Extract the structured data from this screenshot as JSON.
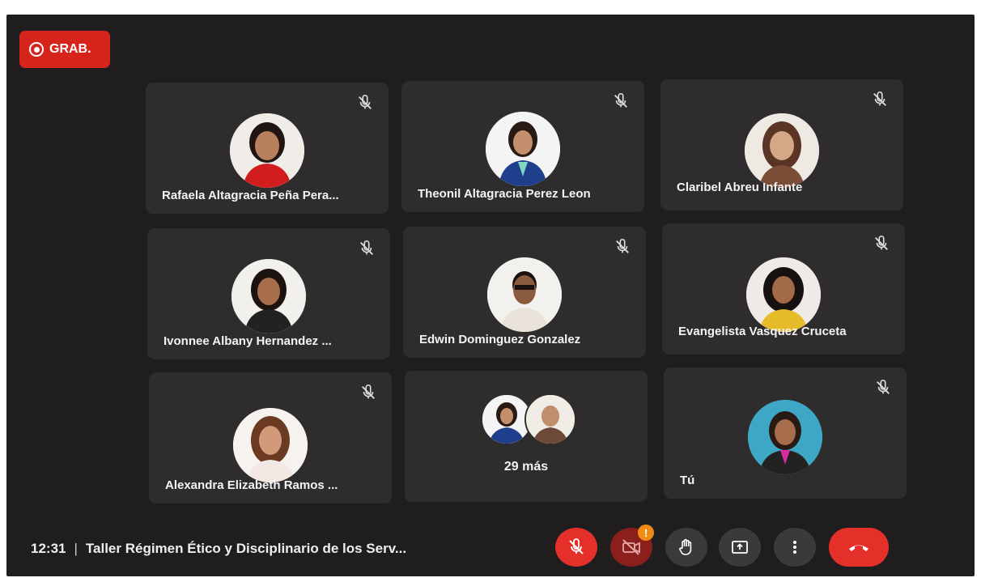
{
  "recording": {
    "label": "GRAB."
  },
  "participants": [
    {
      "name": "Rafaela Altagracia Peña Pera...",
      "muted": true,
      "shirt": "#d11d1d",
      "skin": "#b9805e",
      "hair": "#201512"
    },
    {
      "name": "Theonil Altagracia Perez Leon",
      "muted": true,
      "shirt": "#1f3f8c",
      "skin": "#c48f6c",
      "hair": "#2a1a14"
    },
    {
      "name": "Claribel Abreu Infante",
      "muted": true,
      "shirt": "#7a4d37",
      "skin": "#d5a787",
      "hair": "#5a3526"
    },
    {
      "name": "Ivonnee Albany Hernandez ...",
      "muted": true,
      "shirt": "#222222",
      "skin": "#a86e4c",
      "hair": "#1c120e"
    },
    {
      "name": "Edwin Dominguez Gonzalez",
      "muted": true,
      "shirt": "#e8e2d8",
      "skin": "#8a5a3e",
      "hair": "#1a1210"
    },
    {
      "name": "Evangelista Vasquez Cruceta",
      "muted": true,
      "shirt": "#e6bb2a",
      "skin": "#a36a47",
      "hair": "#161010"
    },
    {
      "name": "Alexandra Elizabeth Ramos ...",
      "muted": true,
      "shirt": "#f4e8e4",
      "skin": "#d09a7b",
      "hair": "#6a3a22"
    }
  ],
  "overflow_tile": {
    "label": "29 más"
  },
  "self_tile": {
    "name": "Tú",
    "muted": true
  },
  "meeting": {
    "time": "12:31",
    "separator": "|",
    "title": "Taller Régimen Ético y Disciplinario de los Serv..."
  },
  "controls": {
    "camera_alert": "!"
  }
}
